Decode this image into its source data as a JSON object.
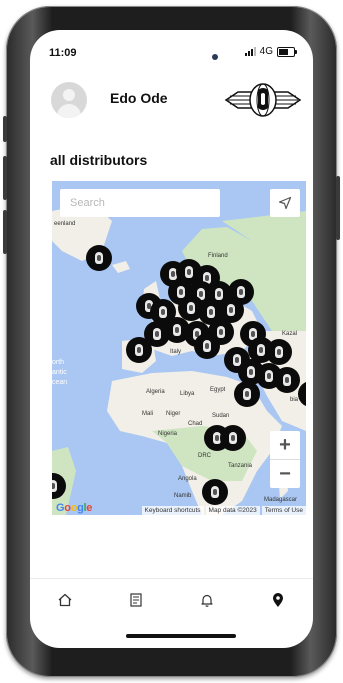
{
  "status_bar": {
    "time": "11:09",
    "network": "4G"
  },
  "header": {
    "username": "Edo Ode",
    "avatar_icon": "user-avatar-icon",
    "logo_icon": "globe-brand-logo"
  },
  "section": {
    "title": "all distributors"
  },
  "map": {
    "search_placeholder": "Search",
    "labels": {
      "greenland": "eenland",
      "finland": "Finland",
      "algeria": "Algeria",
      "libya": "Libya",
      "egypt": "Egypt",
      "mali": "Mali",
      "niger": "Niger",
      "chad": "Chad",
      "sudan": "Sudan",
      "nigeria": "Nigeria",
      "drc": "DRC",
      "tanzania": "Tanzania",
      "angola": "Angola",
      "namibia": "Namib",
      "madagascar": "Madagascar",
      "italy": "Italy",
      "kazakhstan": "Kazal",
      "arabia": "bia",
      "sea_line1": "orth",
      "sea_line2": "antic",
      "sea_line3": "cean"
    },
    "zoom_in": "+",
    "zoom_out": "−",
    "footer": {
      "google": [
        "G",
        "o",
        "o",
        "g",
        "l",
        "e"
      ],
      "keyboard_shortcuts": "Keyboard shortcuts",
      "map_data": "Map data ©2023",
      "terms": "Terms of Use"
    }
  },
  "bottom_nav": {
    "items": [
      {
        "icon": "home-icon"
      },
      {
        "icon": "catalog-icon"
      },
      {
        "icon": "bell-icon"
      },
      {
        "icon": "map-pin-icon"
      }
    ]
  },
  "colors": {
    "ocean": "#a9c7f2",
    "land": "#f2efe8",
    "green_land": "#cfe5c2",
    "marker": "#0b0b0b"
  }
}
